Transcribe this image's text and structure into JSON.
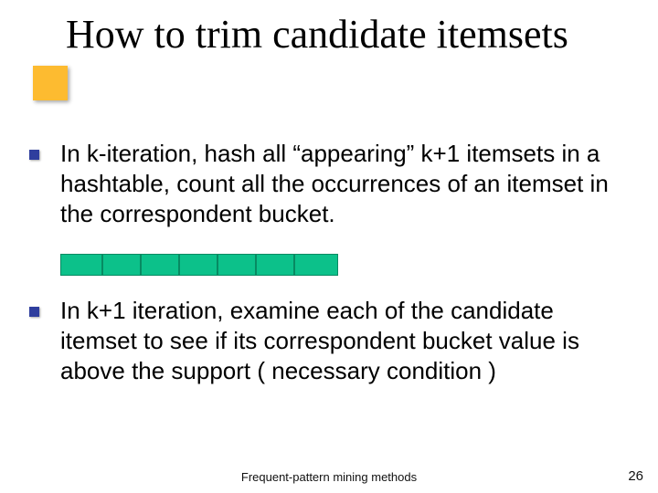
{
  "title": "How to trim candidate itemsets",
  "bullets": [
    {
      "text": "In k-iteration, hash all “appearing”  k+1 itemsets in a hashtable, count all the occurrences of an itemset in the correspondent bucket.",
      "has_buckets": true
    },
    {
      "text": "In k+1 iteration, examine each of the candidate itemset to see if its correspondent bucket value is above the support ( necessary condition )",
      "has_buckets": false
    }
  ],
  "hash_bucket_count": 7,
  "footer": "Frequent-pattern mining methods",
  "page_number": "26",
  "colors": {
    "title_accent": "#fdbb30",
    "bullet_marker": "#2f3e9e",
    "bucket_fill": "#0cc18a",
    "bucket_border": "#078a62"
  }
}
